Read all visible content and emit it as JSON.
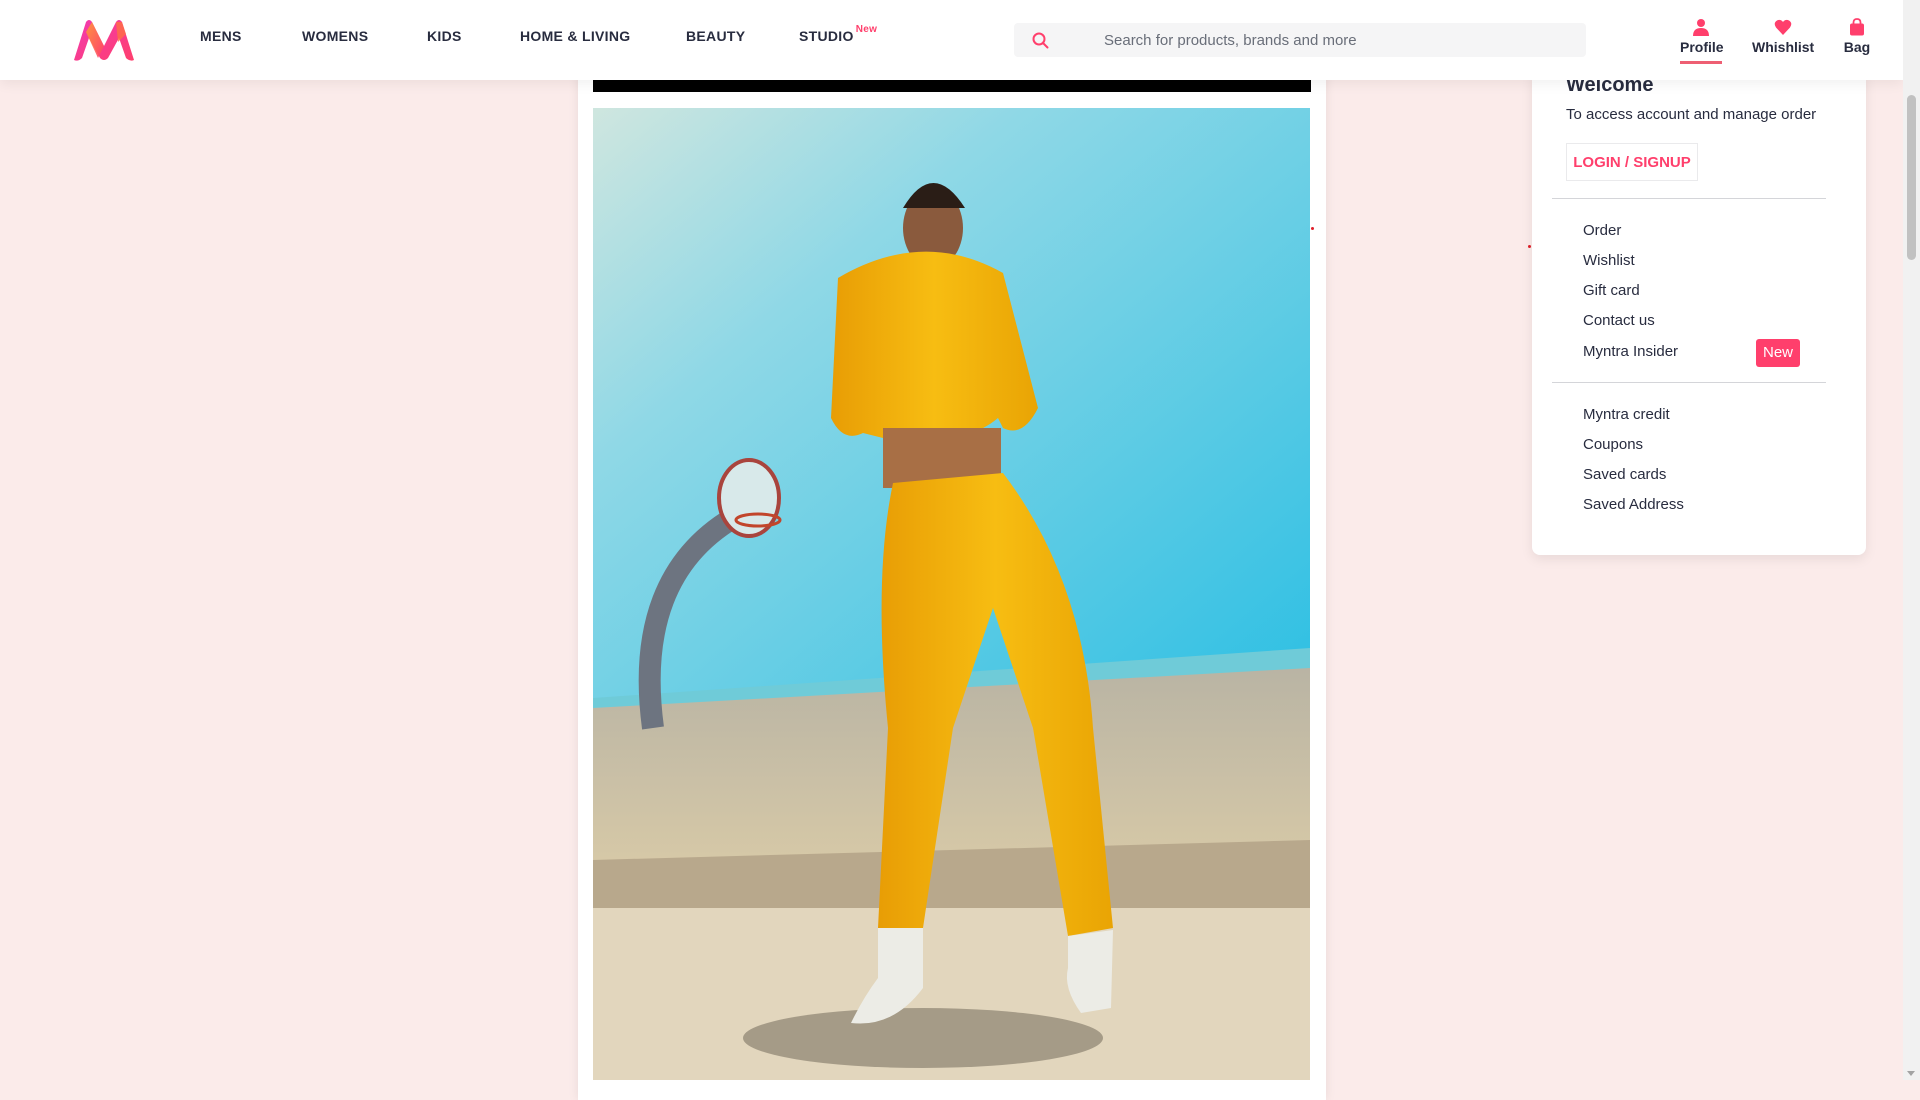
{
  "header": {
    "nav": [
      {
        "label": "MENS"
      },
      {
        "label": "WOMENS"
      },
      {
        "label": "KIDS"
      },
      {
        "label": "HOME & LIVING"
      },
      {
        "label": "BEAUTY"
      },
      {
        "label": "STUDIO",
        "badge": "New"
      }
    ],
    "search": {
      "placeholder": "Search for products, brands and more",
      "value": ""
    },
    "actions": {
      "profile": "Profile",
      "wishlist": "Whishlist",
      "bag": "Bag"
    },
    "logo_icon": "myntra-logo"
  },
  "dropdown": {
    "title": "Welcome",
    "subtitle": "To access account and manage order",
    "login_label": "LOGIN / SIGNUP",
    "group1": [
      "Order",
      "Wishlist",
      "Gift card",
      "Contact us",
      "Myntra Insider"
    ],
    "insider_badge": "New",
    "group2": [
      "Myntra credit",
      "Coupons",
      "Saved cards",
      "Saved Address"
    ]
  },
  "colors": {
    "accent": "#ff3f6c",
    "page_background": "#fbebea",
    "outfit": "#f5b50a",
    "sky": "#3cc3e2"
  },
  "banner": {
    "image_icon": "model-in-yellow-tracksuit-photo"
  }
}
